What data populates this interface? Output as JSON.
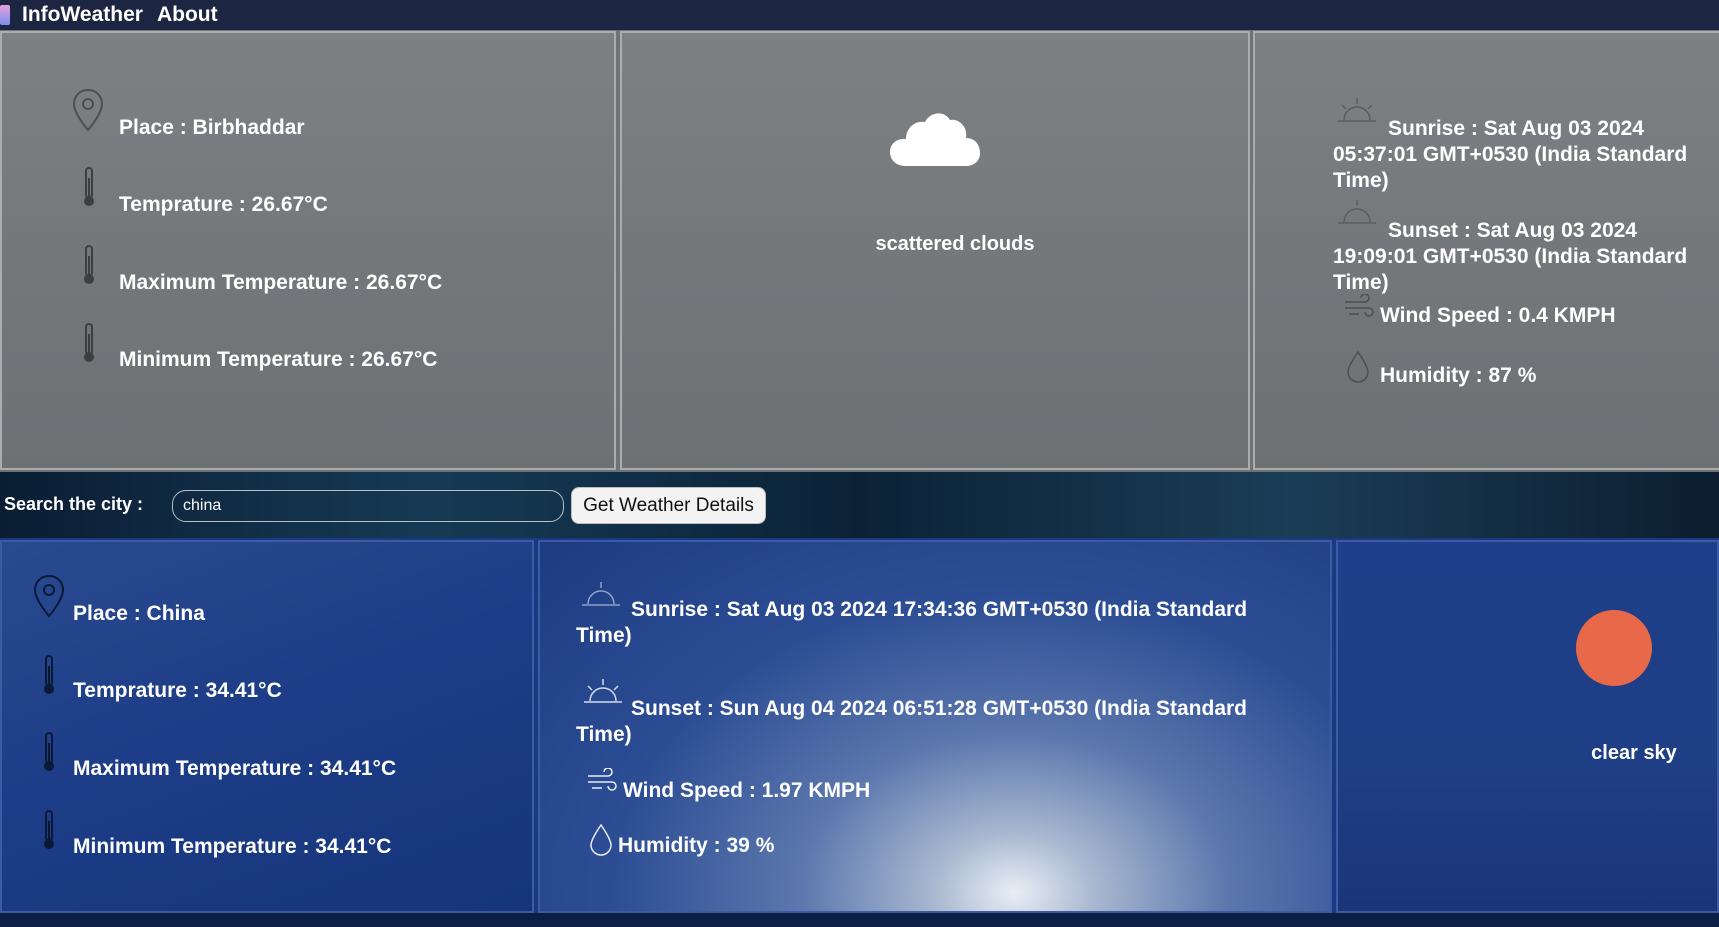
{
  "navbar": {
    "brand": "InfoWeather",
    "about": "About"
  },
  "current": {
    "place": "Place : Birbhaddar",
    "temperature": "Temprature : 26.67°C",
    "max_temperature": "Maximum Temperature : 26.67°C",
    "min_temperature": "Minimum Temperature : 26.67°C",
    "condition": "scattered clouds",
    "sunrise": "Sunrise : Sat Aug 03 2024 05:37:01 GMT+0530 (India Standard Time)",
    "sunset": "Sunset : Sat Aug 03 2024 19:09:01 GMT+0530 (India Standard Time)",
    "wind": "Wind Speed : 0.4 KMPH",
    "humidity": "Humidity : 87 %"
  },
  "search": {
    "label": "Search the city :",
    "value": "china",
    "button": "Get Weather Details"
  },
  "result": {
    "place": "Place : China",
    "temperature": "Temprature : 34.41°C",
    "max_temperature": "Maximum Temperature : 34.41°C",
    "min_temperature": "Minimum Temperature : 34.41°C",
    "sunrise": "Sunrise : Sat Aug 03 2024 17:34:36 GMT+0530 (India Standard Time)",
    "sunset": "Sunset : Sun Aug 04 2024 06:51:28 GMT+0530 (India Standard Time)",
    "wind": "Wind Speed : 1.97 KMPH",
    "humidity": "Humidity : 39 %",
    "condition": "clear sky"
  },
  "colors": {
    "navbar": "#1c2541",
    "sun": "#e8684a",
    "grey_card": "#75797c",
    "blue_card": "#1e3d86"
  },
  "icons": [
    "location-pin-icon",
    "thermometer-icon",
    "cloud-icon",
    "sunrise-icon",
    "sunset-icon",
    "wind-icon",
    "droplet-icon",
    "sun-icon"
  ]
}
